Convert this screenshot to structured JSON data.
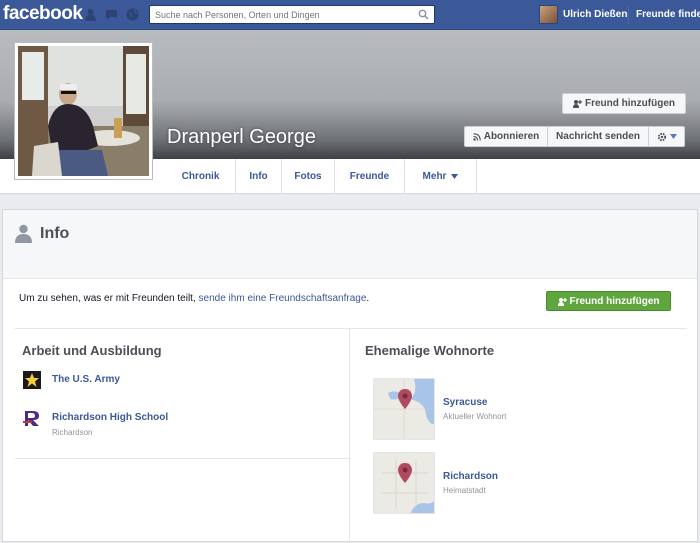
{
  "topbar": {
    "logo": "facebook",
    "search_placeholder": "Suche nach Personen, Orten und Dingen",
    "user_name": "Ulrich Dießen",
    "find_friends": "Freunde finden"
  },
  "profile": {
    "name": "Dranperl George",
    "add_friend": "Freund hinzufügen",
    "subscribe": "Abonnieren",
    "message": "Nachricht senden"
  },
  "tabs": [
    {
      "label": "Chronik"
    },
    {
      "label": "Info"
    },
    {
      "label": "Fotos"
    },
    {
      "label": "Freunde"
    },
    {
      "label": "Mehr"
    }
  ],
  "info": {
    "title": "Info",
    "notice_prefix": "Um zu sehen, was er mit Freunden teilt, ",
    "notice_link": "sende ihm eine Freundschaftsanfrage",
    "notice_suffix": ".",
    "add_friend": "Freund hinzufügen"
  },
  "work": {
    "title": "Arbeit und Ausbildung",
    "items": [
      {
        "name": "The U.S. Army",
        "sub": ""
      },
      {
        "name": "Richardson High School",
        "sub": "Richardson"
      }
    ]
  },
  "places": {
    "title": "Ehemalige Wohnorte",
    "items": [
      {
        "name": "Syracuse",
        "sub": "Aktueller Wohnort"
      },
      {
        "name": "Richardson",
        "sub": "Heimatstadt"
      }
    ]
  },
  "colors": {
    "brand": "#3b5998",
    "green": "#5fa63f"
  }
}
